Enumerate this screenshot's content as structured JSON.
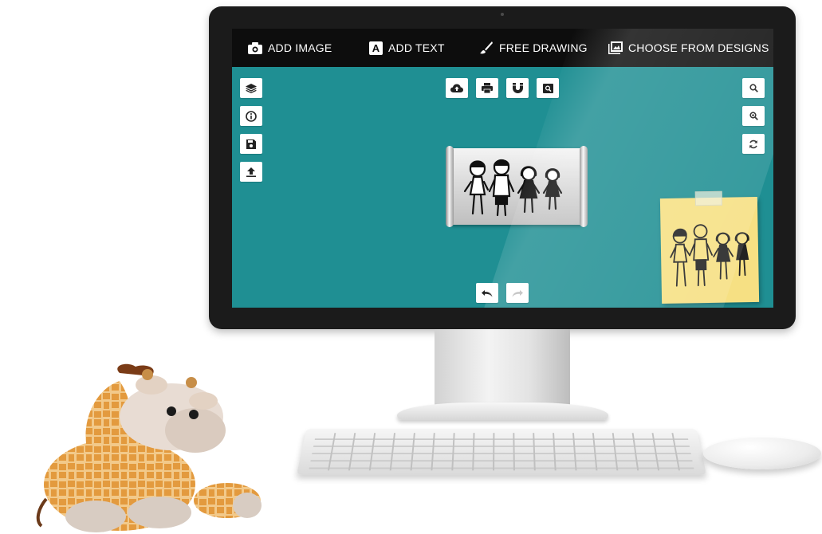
{
  "menu": {
    "add_image": "ADD IMAGE",
    "add_text": "ADD TEXT",
    "text_icon_letter": "A",
    "free_drawing": "FREE DRAWING",
    "choose_designs": "CHOOSE FROM DESIGNS"
  },
  "left_toolbar": [
    "layers-icon",
    "info-icon",
    "save-icon",
    "upload-icon"
  ],
  "top_toolbar": [
    "cloud-upload-icon",
    "print-icon",
    "magnet-icon",
    "preview-icon"
  ],
  "right_toolbar": [
    "zoom-in-icon",
    "zoom-out-icon",
    "refresh-icon"
  ],
  "bottom_toolbar": [
    "undo-icon",
    "redo-icon"
  ],
  "colors": {
    "screen": "#1f8f93",
    "menu_bar": "#0d0d0d",
    "sticky_note": "#f6e083",
    "monitor_bezel": "#1b1b1b"
  }
}
